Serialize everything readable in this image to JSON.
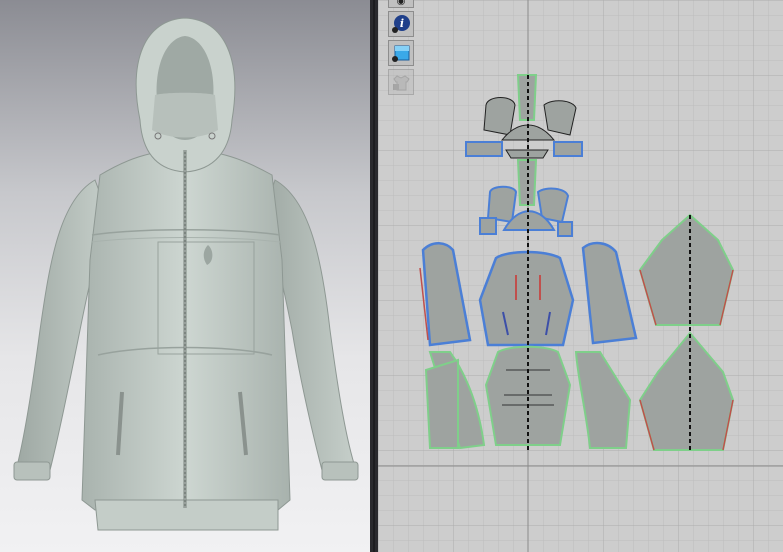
{
  "app": {
    "panels": [
      "3d-garment-view",
      "2d-pattern-view"
    ]
  },
  "toolbar_2d": {
    "buttons": [
      {
        "icon": "eye-icon",
        "enabled": true
      },
      {
        "icon": "info-icon",
        "enabled": true
      },
      {
        "icon": "texture-icon",
        "enabled": true
      },
      {
        "icon": "locked-garment-icon",
        "enabled": false
      }
    ]
  },
  "colors": {
    "garment": "#c2cbc6",
    "pattern_fill": "#9ea3a0",
    "seam_selected": "#4b7fd6",
    "seam_green": "#7fcf8a",
    "seam_red": "#c0504d",
    "grid_bg": "#cdcdcd"
  },
  "grid": {
    "minor_step": 15,
    "major_step": 75,
    "center_axis": "vertical"
  }
}
